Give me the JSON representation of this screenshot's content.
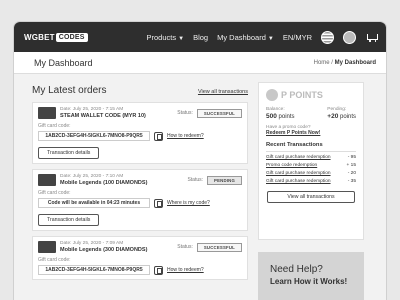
{
  "header": {
    "logo_text": "WGBET",
    "logo_badge": "CODES",
    "nav": [
      "Products",
      "Blog",
      "My Dashboard",
      "EN/MYR"
    ]
  },
  "titlebar": {
    "title": "My Dashboard",
    "breadcrumb_home": "Home",
    "breadcrumb_sep": " / ",
    "breadcrumb_current": "My Dashboard"
  },
  "orders": {
    "title": "My Latest orders",
    "view_all": "View all transactions",
    "status_label": "Status:",
    "giftcard_label": "Gift card code:",
    "details_button": "Transaction details",
    "items": [
      {
        "date": "Date: July 25, 2020 - 7:15 AM",
        "product": "STEAM WALLET CODE (MYR 10)",
        "status": "SUCCESSFUL",
        "code": "1AB2CD-3EFG4H-5IGKL6-7MNO8-P9QR5",
        "link": "How to redeem?"
      },
      {
        "date": "Date: July 25, 2020 - 7:10 AM",
        "product": "Mobile Legends (100 DIAMONDS)",
        "status": "PENDING",
        "code": "Code will be available in 04:23 minutes",
        "link": "Where is my code?"
      },
      {
        "date": "Date: July 25, 2020 - 7:09 AM",
        "product": "Mobile Legends (300 DIAMONDS)",
        "status": "SUCCESSFUL",
        "code": "1AB2CD-3EFG4H-5IGKL6-7MNO8-P9QR5",
        "link": "How to redeem?"
      }
    ]
  },
  "points": {
    "brand": "P POINTS",
    "balance_label": "Balance:",
    "balance_value": "500",
    "pending_label": "Pending:",
    "pending_value": "+20",
    "points_unit": "points",
    "promo_question": "Have a promo code?",
    "promo_link": "Redeem P Points Now!",
    "recent_title": "Recent Transactions",
    "transactions": [
      {
        "name": "Gift card purchase redemption",
        "amount": "- 95"
      },
      {
        "name": "Promo code redemption",
        "amount": "+ 15"
      },
      {
        "name": "Gift card purchase redemption",
        "amount": "- 20"
      },
      {
        "name": "Gift card purchase redemption",
        "amount": "- 35"
      }
    ],
    "view_all_button": "View all transactions"
  },
  "help": {
    "title": "Need Help?",
    "subtitle": "Learn How it Works!"
  }
}
